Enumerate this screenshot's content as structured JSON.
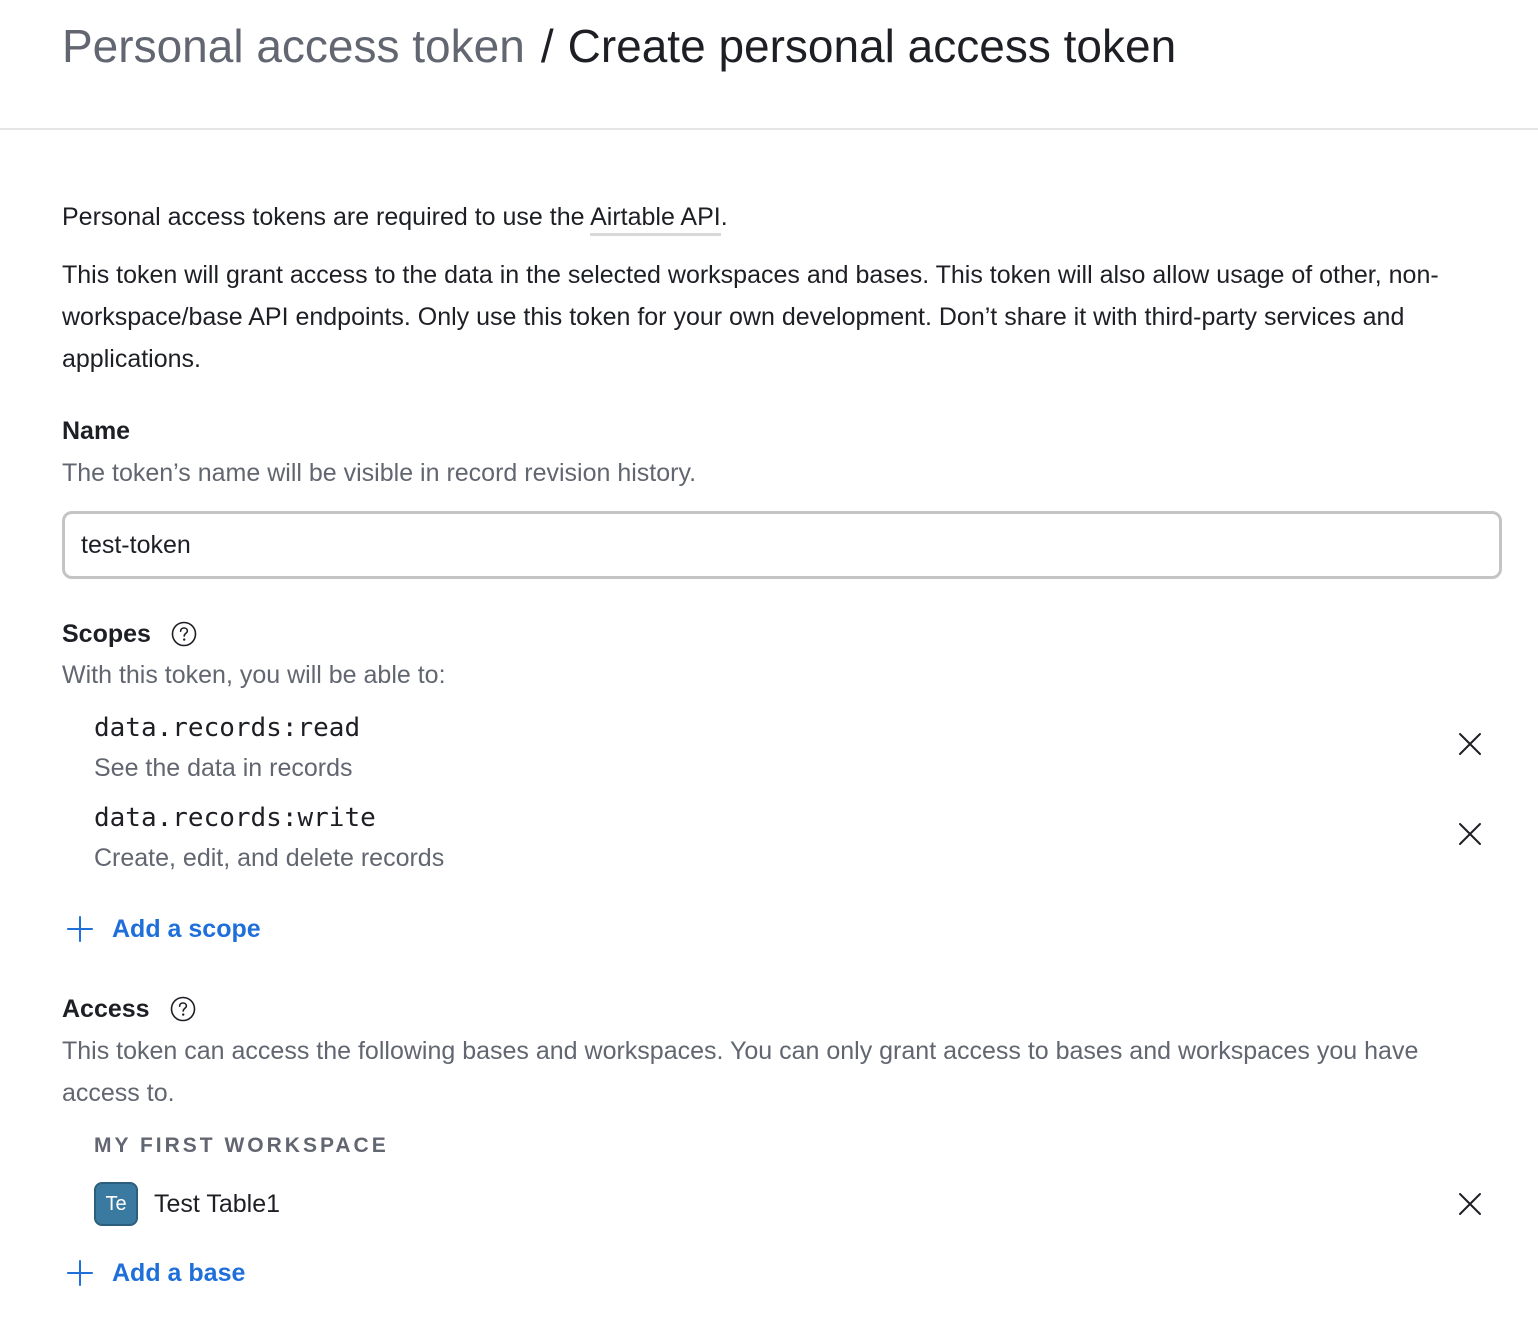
{
  "breadcrumb": {
    "parent": "Personal access token",
    "separator": "/",
    "current": "Create personal access token"
  },
  "intro": {
    "line1_prefix": "Personal access tokens are required to use the ",
    "line1_link": "Airtable API",
    "line1_suffix": ".",
    "description": "This token will grant access to the data in the selected workspaces and bases. This token will also allow usage of other, non-workspace/base API endpoints. Only use this token for your own development. Don’t share it with third-party services and applications."
  },
  "name_section": {
    "label": "Name",
    "hint": "The token’s name will be visible in record revision history.",
    "value": "test-token"
  },
  "scopes_section": {
    "label": "Scopes",
    "hint": "With this token, you will be able to:",
    "items": [
      {
        "name": "data.records:read",
        "description": "See the data in records"
      },
      {
        "name": "data.records:write",
        "description": "Create, edit, and delete records"
      }
    ],
    "add_label": "Add a scope"
  },
  "access_section": {
    "label": "Access",
    "hint": "This token can access the following bases and workspaces. You can only grant access to bases and workspaces you have access to.",
    "workspace": "MY FIRST WORKSPACE",
    "bases": [
      {
        "abbr": "Te",
        "name": "Test Table1"
      }
    ],
    "add_label": "Add a base"
  },
  "colors": {
    "accent": "#1f6fdb",
    "muted_text": "#616670",
    "base_avatar": "#3a7aa0"
  }
}
